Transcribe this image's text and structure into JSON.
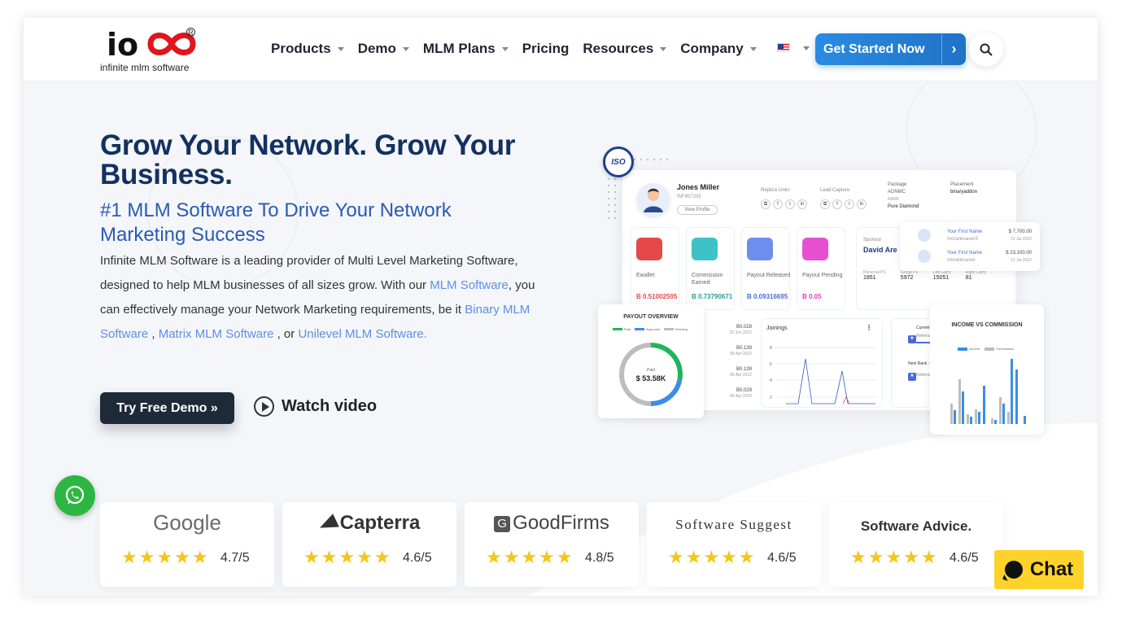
{
  "header": {
    "logo_mark": "io",
    "logo_tagline": "infinite mlm software",
    "nav": [
      {
        "label": "Products",
        "has_dropdown": true
      },
      {
        "label": "Demo",
        "has_dropdown": true
      },
      {
        "label": "MLM Plans",
        "has_dropdown": true
      },
      {
        "label": "Pricing",
        "has_dropdown": false
      },
      {
        "label": "Resources",
        "has_dropdown": true
      },
      {
        "label": "Company",
        "has_dropdown": true
      }
    ],
    "language_flag": "us-flag-icon",
    "cta_label": "Get Started Now",
    "cta_arrow": "›"
  },
  "hero": {
    "title": "Grow Your Network. Grow Your Business.",
    "subtitle": "#1 MLM Software To Drive Your Network Marketing Success",
    "desc_1": "Infinite MLM Software is a leading provider of Multi Level Marketing Software, designed to help MLM businesses of all sizes grow. With our ",
    "link_mlm": "MLM Software",
    "desc_2": ", you can effectively manage your Network Marketing requirements, be it ",
    "link_binary": "Binary MLM Software",
    "desc_3": " , ",
    "link_matrix": "Matrix MLM Software",
    "desc_4": " , or ",
    "link_unilevel": "Unilevel MLM Software.",
    "demo_button": "Try Free Demo »",
    "watch_video": "Watch video"
  },
  "dashboard": {
    "iso_badge": "ISO",
    "user_name": "Jones Miller",
    "user_id": "INF857335",
    "view_profile": "View Profile",
    "replica_links": "Replica Links",
    "lead_capture": "Lead Capture",
    "package_label": "Package",
    "package_value": "ADNMC",
    "rank_label": "RANK",
    "rank_value": "Pure Diamond",
    "placement_label": "Placement",
    "placement_value": "binaryaddon",
    "tiles": [
      {
        "label": "Ewallet",
        "value": "B 0.51002505",
        "color": "#e54848",
        "value_color": "#e54848"
      },
      {
        "label": "Commission Earned",
        "value": "B 0.73790671",
        "color": "#3cc2c7",
        "value_color": "#2b9ba0"
      },
      {
        "label": "Payout Released",
        "value": "B 0.09316695",
        "color": "#6c8ef0",
        "value_color": "#4b6ad8"
      },
      {
        "label": "Payout Pending",
        "value": "B 0.05",
        "color": "#e64fd2",
        "value_color": "#d23fbd"
      }
    ],
    "sponsor_label": "Sponsor",
    "sponsor_name": "David Are",
    "stats": [
      {
        "label": "Personal PV",
        "value": "1851"
      },
      {
        "label": "Group PV",
        "value": "5972"
      },
      {
        "label": "Left Carry",
        "value": "15051"
      },
      {
        "label": "Right Carry",
        "value": "81"
      }
    ],
    "members": [
      {
        "name": "Your First Name",
        "user": "moranksaver3",
        "amount": "$ 7,700.00",
        "date": "12 Jul 2022"
      },
      {
        "name": "Your First Name",
        "user": "moranksaver",
        "amount": "$ 23,100.00",
        "date": "12 Jul 2022"
      }
    ],
    "payout_title": "PAYOUT OVERVIEW",
    "payout_legend": [
      "Paid",
      "Approved",
      "Pending"
    ],
    "payout_center_label": "Paid",
    "payout_center_value": "$ 53.58K",
    "payout_paid_fraction": 0.28,
    "payout_approved_fraction": 0.22,
    "payout_pending_fraction": 0.5,
    "trx": [
      {
        "amount": "B0.028",
        "date": "22 Jun 2022"
      },
      {
        "amount": "B0.139",
        "date": "06 Apr 2022"
      },
      {
        "amount": "B0.139",
        "date": "06 Apr 2022"
      },
      {
        "amount": "B0.029",
        "date": "06 Apr 2022"
      }
    ],
    "joinings_title": "Joinings",
    "joinings_ticks": [
      "8",
      "6",
      "4",
      "2"
    ],
    "current_rank": "Current Rank - P",
    "referral_count": "Referral Cou",
    "next_rank": "Next Rank - Dian",
    "referral_count_2": "Referral Cou",
    "income_title": "INCOME VS COMMISSION",
    "income_legend": [
      "Income",
      "Commission"
    ]
  },
  "reviews": [
    {
      "brand": "Google",
      "stars": "★★★★★",
      "rating": "4.7/5"
    },
    {
      "brand": "Capterra",
      "stars": "★★★★★",
      "rating": "4.6/5"
    },
    {
      "brand": "GoodFirms",
      "stars": "★★★★★",
      "rating": "4.8/5"
    },
    {
      "brand": "Software Suggest",
      "stars": "★★★★★",
      "rating": "4.6/5"
    },
    {
      "brand": "Software Advice.",
      "stars": "★★★★★",
      "rating": "4.6/5"
    }
  ],
  "chat_label": "Chat"
}
